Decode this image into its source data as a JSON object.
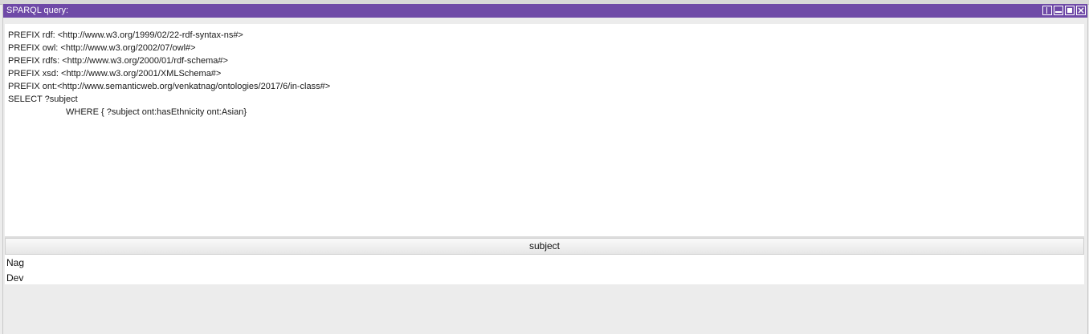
{
  "window": {
    "title": "SPARQL query:",
    "controls": [
      {
        "name": "split-view-icon"
      },
      {
        "name": "minimize-icon"
      },
      {
        "name": "maximize-icon"
      },
      {
        "name": "close-icon"
      }
    ]
  },
  "query": {
    "lines": [
      "PREFIX rdf: <http://www.w3.org/1999/02/22-rdf-syntax-ns#>",
      "PREFIX owl: <http://www.w3.org/2002/07/owl#>",
      "PREFIX rdfs: <http://www.w3.org/2000/01/rdf-schema#>",
      "PREFIX xsd: <http://www.w3.org/2001/XMLSchema#>",
      "PREFIX ont:<http://www.semanticweb.org/venkatnag/ontologies/2017/6/in-class#>",
      "SELECT ?subject",
      "WHERE { ?subject ont:hasEthnicity ont:Asian}"
    ]
  },
  "results": {
    "columns": [
      "subject"
    ],
    "rows": [
      [
        "Nag"
      ],
      [
        "Dev"
      ]
    ]
  },
  "colors": {
    "titlebar": "#6f4aa7",
    "background": "#ececec"
  }
}
